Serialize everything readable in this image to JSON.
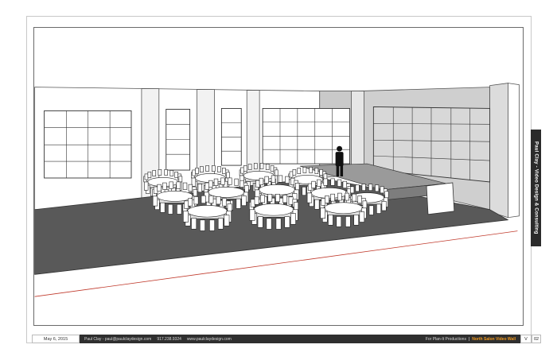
{
  "sidebar": {
    "tab_label": "Paul Clay - Video Design & Consulting"
  },
  "footer": {
    "date": "May 6, 2015",
    "author": "Paul Clay",
    "email": "paul@paulclaydesign.com",
    "phone": "917.238.9324",
    "website": "www.paulclaydesign.com",
    "client": "For Plan-It Productions",
    "separator": "|",
    "project": "North Salon Video Wall",
    "version": "V",
    "page": "02"
  },
  "colors": {
    "floor": "#595959",
    "wall": "#ffffff",
    "wall_shade": "#c9c9c9",
    "accent_line": "#c0392b",
    "bar": "#2f2f2f",
    "highlight": "#f39a1e"
  },
  "scene": {
    "table_count": 12,
    "icons": [
      "video-wall-icon",
      "round-table-icon",
      "chair-icon",
      "person-silhouette-icon",
      "stage-icon"
    ]
  }
}
